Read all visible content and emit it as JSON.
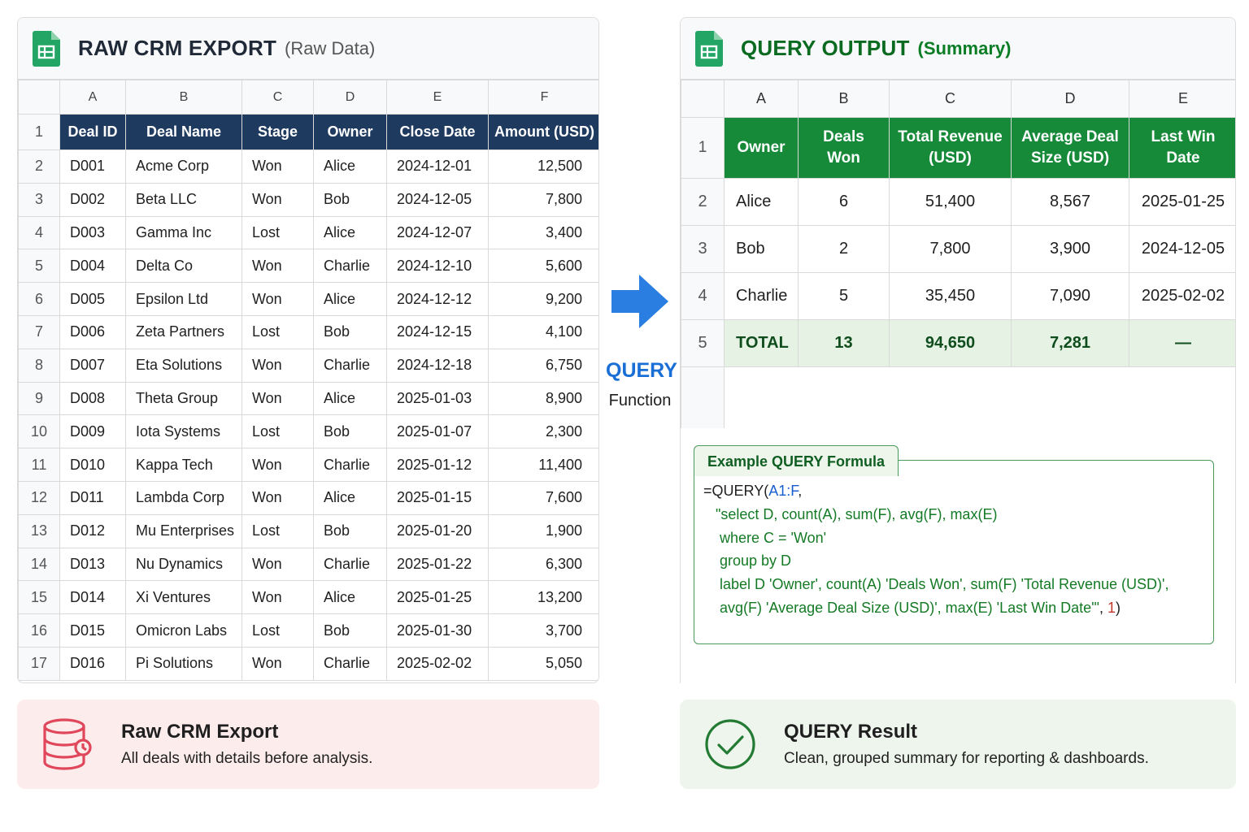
{
  "raw_panel": {
    "title": "RAW CRM EXPORT",
    "subtitle": "(Raw Data)",
    "icon": "google-sheets-icon",
    "columns": [
      "A",
      "B",
      "C",
      "D",
      "E",
      "F"
    ],
    "headers": [
      "Deal ID",
      "Deal Name",
      "Stage",
      "Owner",
      "Close Date",
      "Amount (USD)"
    ],
    "rows": [
      {
        "row": "2",
        "cells": [
          "D001",
          "Acme Corp",
          "Won",
          "Alice",
          "2024-12-01",
          "12,500"
        ]
      },
      {
        "row": "3",
        "cells": [
          "D002",
          "Beta LLC",
          "Won",
          "Bob",
          "2024-12-05",
          "7,800"
        ]
      },
      {
        "row": "4",
        "cells": [
          "D003",
          "Gamma Inc",
          "Lost",
          "Alice",
          "2024-12-07",
          "3,400"
        ]
      },
      {
        "row": "5",
        "cells": [
          "D004",
          "Delta Co",
          "Won",
          "Charlie",
          "2024-12-10",
          "5,600"
        ]
      },
      {
        "row": "6",
        "cells": [
          "D005",
          "Epsilon Ltd",
          "Won",
          "Alice",
          "2024-12-12",
          "9,200"
        ]
      },
      {
        "row": "7",
        "cells": [
          "D006",
          "Zeta Partners",
          "Lost",
          "Bob",
          "2024-12-15",
          "4,100"
        ]
      },
      {
        "row": "8",
        "cells": [
          "D007",
          "Eta Solutions",
          "Won",
          "Charlie",
          "2024-12-18",
          "6,750"
        ]
      },
      {
        "row": "9",
        "cells": [
          "D008",
          "Theta Group",
          "Won",
          "Alice",
          "2025-01-03",
          "8,900"
        ]
      },
      {
        "row": "10",
        "cells": [
          "D009",
          "Iota Systems",
          "Lost",
          "Bob",
          "2025-01-07",
          "2,300"
        ]
      },
      {
        "row": "11",
        "cells": [
          "D010",
          "Kappa Tech",
          "Won",
          "Charlie",
          "2025-01-12",
          "11,400"
        ]
      },
      {
        "row": "12",
        "cells": [
          "D011",
          "Lambda Corp",
          "Won",
          "Alice",
          "2025-01-15",
          "7,600"
        ]
      },
      {
        "row": "13",
        "cells": [
          "D012",
          "Mu Enterprises",
          "Lost",
          "Bob",
          "2025-01-20",
          "1,900"
        ]
      },
      {
        "row": "14",
        "cells": [
          "D013",
          "Nu Dynamics",
          "Won",
          "Charlie",
          "2025-01-22",
          "6,300"
        ]
      },
      {
        "row": "15",
        "cells": [
          "D014",
          "Xi Ventures",
          "Won",
          "Alice",
          "2025-01-25",
          "13,200"
        ]
      },
      {
        "row": "16",
        "cells": [
          "D015",
          "Omicron Labs",
          "Lost",
          "Bob",
          "2025-01-30",
          "3,700"
        ]
      },
      {
        "row": "17",
        "cells": [
          "D016",
          "Pi Solutions",
          "Won",
          "Charlie",
          "2025-02-02",
          "5,050"
        ]
      }
    ]
  },
  "arrow": {
    "label": "QUERY",
    "sublabel": "Function",
    "icon": "right-arrow-icon"
  },
  "query_panel": {
    "title": "QUERY OUTPUT",
    "subtitle": "(Summary)",
    "icon": "google-sheets-icon",
    "columns": [
      "A",
      "B",
      "C",
      "D",
      "E"
    ],
    "headers": [
      [
        "Owner"
      ],
      [
        "Deals",
        "Won"
      ],
      [
        "Total Revenue",
        "(USD)"
      ],
      [
        "Average Deal",
        "Size (USD)"
      ],
      [
        "Last Win",
        "Date"
      ]
    ],
    "rows": [
      {
        "row": "2",
        "cells": [
          "Alice",
          "6",
          "51,400",
          "8,567",
          "2025-01-25"
        ]
      },
      {
        "row": "3",
        "cells": [
          "Bob",
          "2",
          "7,800",
          "3,900",
          "2024-12-05"
        ]
      },
      {
        "row": "4",
        "cells": [
          "Charlie",
          "5",
          "35,450",
          "7,090",
          "2025-02-02"
        ]
      }
    ],
    "total": {
      "row": "5",
      "cells": [
        "TOTAL",
        "13",
        "94,650",
        "7,281",
        "—"
      ]
    }
  },
  "formula": {
    "tab_label": "Example QUERY Formula",
    "lines": [
      [
        {
          "t": "plain",
          "s": "=QUERY("
        },
        {
          "t": "ref",
          "s": "A1:F"
        },
        {
          "t": "plain",
          "s": ","
        }
      ],
      [
        {
          "t": "str",
          "s": "   \"select D, count(A), sum(F), avg(F), max(E)"
        }
      ],
      [
        {
          "t": "str",
          "s": "    where C = 'Won'"
        }
      ],
      [
        {
          "t": "str",
          "s": "    group by D"
        }
      ],
      [
        {
          "t": "str",
          "s": "    label D 'Owner', count(A) 'Deals Won', sum(F) 'Total Revenue (USD)',"
        }
      ],
      [
        {
          "t": "str",
          "s": "    avg(F) 'Average Deal Size (USD)', max(E) 'Last Win Date'\""
        },
        {
          "t": "plain",
          "s": ", "
        },
        {
          "t": "num",
          "s": "1"
        },
        {
          "t": "plain",
          "s": ")"
        }
      ]
    ]
  },
  "cards": {
    "raw": {
      "title": "Raw CRM Export",
      "description": "All deals with details before analysis.",
      "icon": "database-icon"
    },
    "result": {
      "title": "QUERY Result",
      "description": "Clean, grouped summary for reporting & dashboards.",
      "icon": "check-circle-icon"
    }
  },
  "colors": {
    "raw_header_bg": "#1f3a5f",
    "summary_header_bg": "#178a3a",
    "total_row_bg": "#e6f2e4",
    "query_blue": "#1a6fd6",
    "raw_card_bg": "#fdecec",
    "result_card_bg": "#eef5ec"
  }
}
